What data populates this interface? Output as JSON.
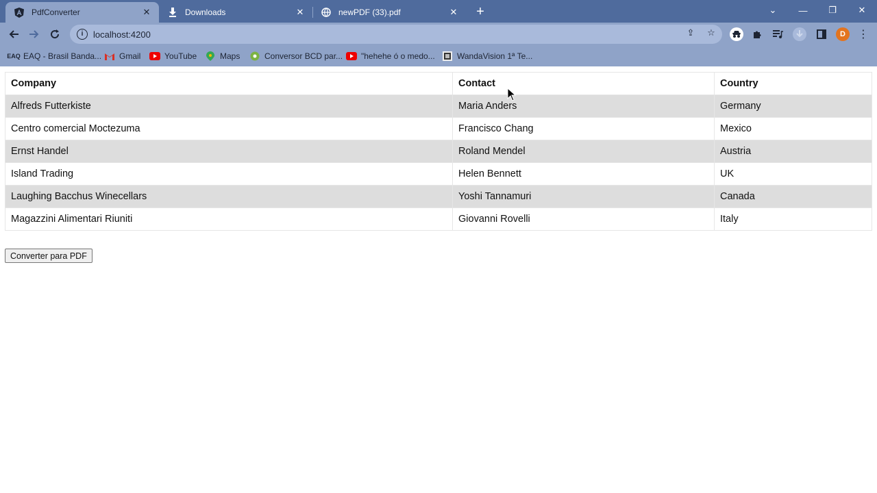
{
  "browser": {
    "tabs": [
      {
        "title": "PdfConverter",
        "favicon": "angular-icon",
        "active": true
      },
      {
        "title": "Downloads",
        "favicon": "download-icon",
        "active": false
      },
      {
        "title": "newPDF (33).pdf",
        "favicon": "globe-icon",
        "active": false
      }
    ],
    "address": "localhost:4200",
    "profile_initial": "D",
    "bookmarks": [
      {
        "label": "EAQ - Brasil Banda...",
        "icon": "eaq-icon"
      },
      {
        "label": "Gmail",
        "icon": "gmail-icon"
      },
      {
        "label": "YouTube",
        "icon": "youtube-icon"
      },
      {
        "label": "Maps",
        "icon": "maps-icon"
      },
      {
        "label": "Conversor BCD par...",
        "icon": "converter-icon"
      },
      {
        "label": "\"hehehe ó o medo...",
        "icon": "youtube-icon"
      },
      {
        "label": "WandaVision 1ª Te...",
        "icon": "film-icon"
      }
    ]
  },
  "table": {
    "headers": [
      "Company",
      "Contact",
      "Country"
    ],
    "rows": [
      [
        "Alfreds Futterkiste",
        "Maria Anders",
        "Germany"
      ],
      [
        "Centro comercial Moctezuma",
        "Francisco Chang",
        "Mexico"
      ],
      [
        "Ernst Handel",
        "Roland Mendel",
        "Austria"
      ],
      [
        "Island Trading",
        "Helen Bennett",
        "UK"
      ],
      [
        "Laughing Bacchus Winecellars",
        "Yoshi Tannamuri",
        "Canada"
      ],
      [
        "Magazzini Alimentari Riuniti",
        "Giovanni Rovelli",
        "Italy"
      ]
    ]
  },
  "convert_button_label": "Converter para PDF",
  "colors": {
    "chrome_dark": "#4f6b9d",
    "chrome_light": "#8fa3c8",
    "row_stripe": "#dddddd",
    "avatar": "#e3741f"
  }
}
